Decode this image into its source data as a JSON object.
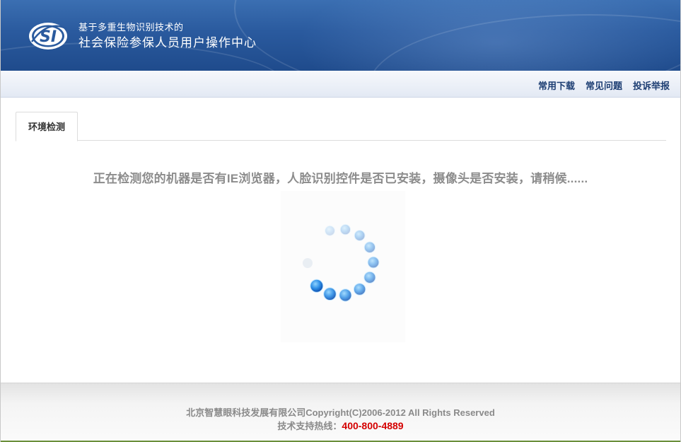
{
  "header": {
    "logo_text": "SI",
    "subtitle": "基于多重生物识别技术的",
    "title": "社会保险参保人员用户操作中心"
  },
  "nav": {
    "links": [
      "常用下载",
      "常见问题",
      "投诉举报"
    ]
  },
  "tabs": [
    {
      "label": "环境检测",
      "active": true
    }
  ],
  "main": {
    "detect_message": "正在检测您的机器是否有IE浏览器，人脸识别控件是否已安装，摄像头是否安装，请稍候......",
    "spinner_icon": "loading-spinner-icon"
  },
  "footer": {
    "copyright": "北京智慧眼科技发展有限公司Copyright(C)2006-2012 All Rights Reserved",
    "support_label": "技术支持热线：",
    "hotline": "400-800-4889"
  },
  "colors": {
    "header_blue": "#2a5a9e",
    "nav_link": "#1d3e73",
    "hotline_red": "#d40000",
    "spinner_blue": "#1e6fd6"
  }
}
